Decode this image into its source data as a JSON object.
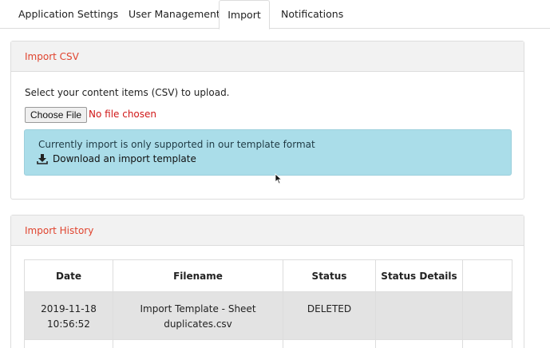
{
  "tabs": [
    {
      "label": "Application Settings",
      "active": false
    },
    {
      "label": "User Management",
      "active": false
    },
    {
      "label": "Import",
      "active": true
    },
    {
      "label": "Notifications",
      "active": false
    }
  ],
  "import_csv": {
    "title": "Import CSV",
    "help_text": "Select your content items (CSV) to upload.",
    "choose_file_label": "Choose File",
    "no_file_text": "No file chosen",
    "info_text": "Currently import is only supported in our template format",
    "download_link_label": "Download an import template"
  },
  "import_history": {
    "title": "Import History",
    "columns": [
      "Date",
      "Filename",
      "Status",
      "Status Details",
      ""
    ],
    "rows": [
      {
        "date_line1": "2019-11-18",
        "date_line2": "10:56:52",
        "filename_line1": "Import Template - Sheet",
        "filename_line2": "duplicates.csv",
        "status": "DELETED",
        "status_details": "",
        "extra": ""
      }
    ]
  },
  "colors": {
    "panel_title": "#e0442f",
    "no_file": "#d01818",
    "info_bg": "#aadde9",
    "heading_bg": "#f2f2f2",
    "row_bg": "#e3e3e3"
  },
  "icons": {
    "download": "download-icon",
    "cursor": "mouse-pointer-icon"
  }
}
